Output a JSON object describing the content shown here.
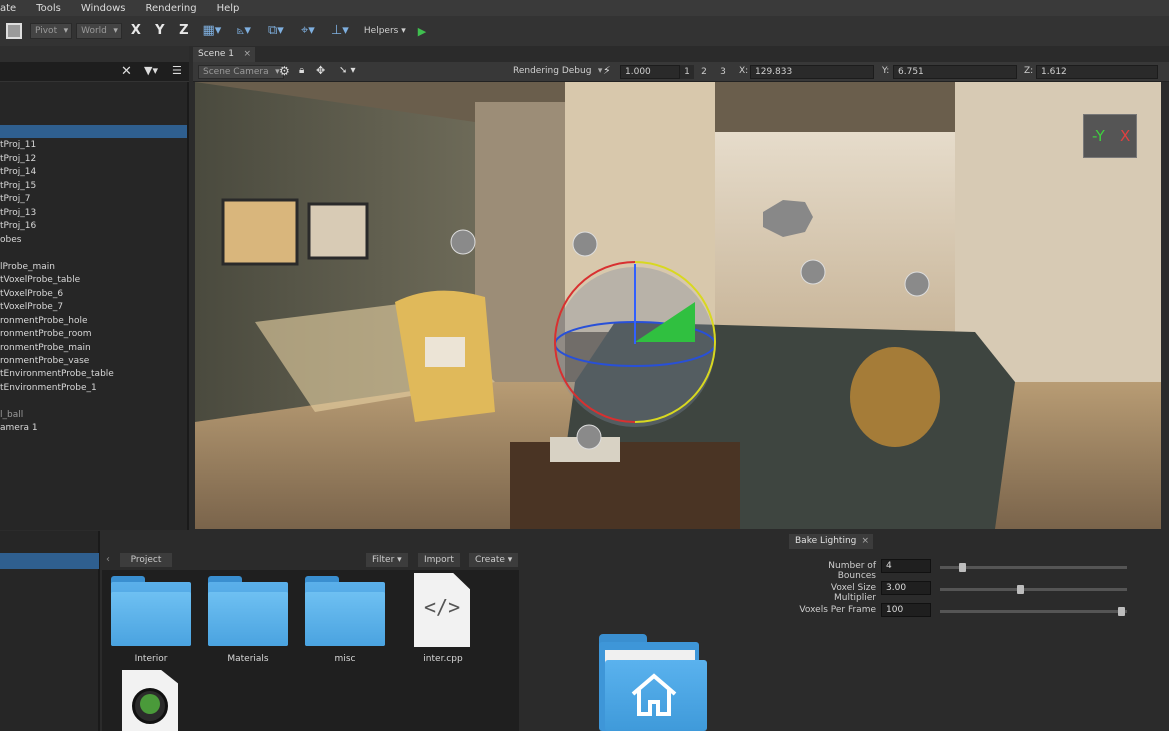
{
  "menu": [
    "ate",
    "Tools",
    "Windows",
    "Rendering",
    "Help"
  ],
  "toolbar": {
    "pivot": "Pivot",
    "world": "World",
    "x": "X",
    "y": "Y",
    "z": "Z",
    "helpers": "Helpers"
  },
  "hierarchy": {
    "items": [
      "tProj_11",
      "tProj_12",
      "tProj_14",
      "tProj_15",
      "tProj_7",
      "tProj_13",
      "tProj_16",
      "obes",
      "lProbe_main",
      "tVoxelProbe_table",
      "tVoxelProbe_6",
      "tVoxelProbe_7",
      "ronmentProbe_hole",
      "ronmentProbe_room",
      "ronmentProbe_main",
      "ronmentProbe_vase",
      "tEnvironmentProbe_table",
      "tEnvironmentProbe_1",
      "l_ball",
      "amera 1"
    ]
  },
  "scene": {
    "tab": "Scene 1",
    "camera": "Scene Camera",
    "rendering_debug": "Rendering Debug",
    "speed": "1.000",
    "num1": "1",
    "num2": "2",
    "num3": "3",
    "x_label": "X:",
    "x_value": "129.833",
    "y_label": "Y:",
    "y_value": "6.751",
    "z_label": "Z:",
    "z_value": "1.612",
    "axis_y": "-Y",
    "axis_x": "X"
  },
  "project": {
    "tab": "Project",
    "filter": "Filter",
    "import": "Import",
    "create": "Create",
    "items": [
      "Interior",
      "Materials",
      "misc",
      "inter.cpp"
    ]
  },
  "bake": {
    "tab": "Bake Lighting",
    "bounces_label": "Number of Bounces",
    "bounces_value": "4",
    "bounces_fraction": 0.12,
    "voxel_label": "Voxel Size Multiplier",
    "voxel_value": "3.00",
    "voxel_fraction": 0.43,
    "vpf_label": "Voxels Per Frame",
    "vpf_value": "100",
    "vpf_fraction": 0.97
  },
  "colors": {
    "selection": "#2f5f8f",
    "folder": "#4aa3e0",
    "play": "#3fbf4f"
  }
}
